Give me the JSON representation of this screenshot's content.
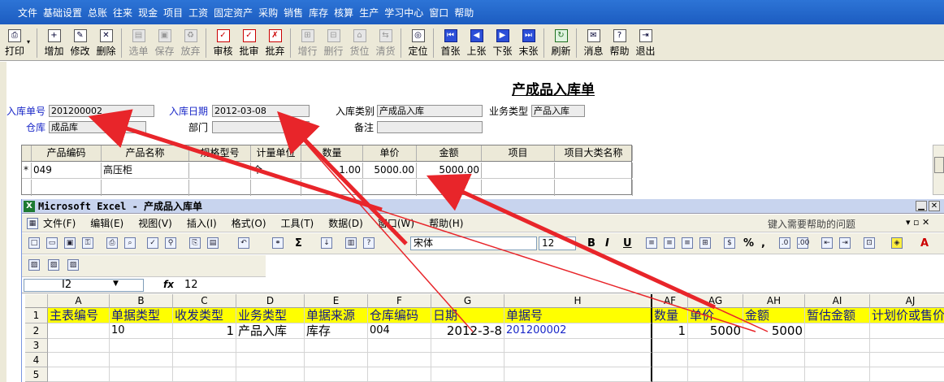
{
  "menubar": [
    "文件",
    "基础设置",
    "总账",
    "往来",
    "现金",
    "项目",
    "工资",
    "固定资产",
    "采购",
    "销售",
    "库存",
    "核算",
    "生产",
    "学习中心",
    "窗口",
    "帮助"
  ],
  "toolbar": {
    "print": "打印",
    "buttons": [
      {
        "label": "增加",
        "disabled": false,
        "icon": "plus-icon",
        "glyph": "+"
      },
      {
        "label": "修改",
        "disabled": false,
        "icon": "edit-icon",
        "glyph": "✎"
      },
      {
        "label": "删除",
        "disabled": false,
        "icon": "delete-icon",
        "glyph": "✕"
      },
      {
        "label": "选单",
        "disabled": true,
        "icon": "select-icon",
        "glyph": "▤"
      },
      {
        "label": "保存",
        "disabled": true,
        "icon": "save-icon",
        "glyph": "▣"
      },
      {
        "label": "放弃",
        "disabled": true,
        "icon": "trash-icon",
        "glyph": "♻"
      },
      {
        "label": "审核",
        "disabled": false,
        "icon": "audit-icon",
        "glyph": "✓",
        "tone": "red"
      },
      {
        "label": "批审",
        "disabled": false,
        "icon": "batch-audit-icon",
        "glyph": "✓",
        "tone": "red"
      },
      {
        "label": "批弃",
        "disabled": false,
        "icon": "batch-abandon-icon",
        "glyph": "✗",
        "tone": "red"
      },
      {
        "label": "增行",
        "disabled": true,
        "icon": "add-row-icon",
        "glyph": "⊞"
      },
      {
        "label": "删行",
        "disabled": true,
        "icon": "delete-row-icon",
        "glyph": "⊟"
      },
      {
        "label": "货位",
        "disabled": true,
        "icon": "location-icon",
        "glyph": "⌂"
      },
      {
        "label": "清货",
        "disabled": true,
        "icon": "clear-goods-icon",
        "glyph": "⇆"
      },
      {
        "label": "定位",
        "disabled": false,
        "icon": "locate-icon",
        "glyph": "◎"
      },
      {
        "label": "首张",
        "disabled": false,
        "icon": "first-icon",
        "glyph": "⏮",
        "tone": "blue"
      },
      {
        "label": "上张",
        "disabled": false,
        "icon": "prev-icon",
        "glyph": "◀",
        "tone": "blue"
      },
      {
        "label": "下张",
        "disabled": false,
        "icon": "next-icon",
        "glyph": "▶",
        "tone": "blue"
      },
      {
        "label": "末张",
        "disabled": false,
        "icon": "last-icon",
        "glyph": "⏭",
        "tone": "blue"
      },
      {
        "label": "刷新",
        "disabled": false,
        "icon": "refresh-icon",
        "glyph": "↻",
        "tone": "green"
      },
      {
        "label": "消息",
        "disabled": false,
        "icon": "message-icon",
        "glyph": "✉"
      },
      {
        "label": "帮助",
        "disabled": false,
        "icon": "help-icon",
        "glyph": "?"
      },
      {
        "label": "退出",
        "disabled": false,
        "icon": "exit-icon",
        "glyph": "⇥"
      }
    ]
  },
  "form": {
    "title": "产成品入库单",
    "doc_no_label": "入库单号",
    "doc_no": "201200002",
    "date_label": "入库日期",
    "date": "2012-03-08",
    "type_label": "入库类别",
    "type": "产成品入库",
    "biz_label": "业务类型",
    "biz": "产品入库",
    "wh_label": "仓库",
    "wh": "成品库",
    "dept_label": "部门",
    "dept": "",
    "note_label": "备注",
    "note": "",
    "grid_headers": [
      "产品编码",
      "产品名称",
      "规格型号",
      "计量单位",
      "数量",
      "单价",
      "金额",
      "项目",
      "项目大类名称"
    ],
    "grid_row": {
      "marker": "*",
      "code": "049",
      "name": "高压柜",
      "spec": "",
      "unit": "个",
      "qty": "1.00",
      "price": "5000.00",
      "amount": "5000.00",
      "proj": "",
      "projcat": ""
    }
  },
  "excel": {
    "title": "Microsoft Excel - 产成品入库单",
    "menu": [
      "文件(F)",
      "编辑(E)",
      "视图(V)",
      "插入(I)",
      "格式(O)",
      "工具(T)",
      "数据(D)",
      "窗口(W)",
      "帮助(H)"
    ],
    "help_placeholder": "键入需要帮助的问题",
    "font_name": "宋体",
    "font_size": "12",
    "name_box": "I2",
    "fx": "fx",
    "formula_value": "12",
    "col_letters": [
      "A",
      "B",
      "C",
      "D",
      "E",
      "F",
      "G",
      "H",
      "AF",
      "AG",
      "AH",
      "AI",
      "AJ"
    ],
    "row_numbers": [
      "1",
      "2",
      "3",
      "4",
      "5"
    ],
    "header_row": [
      "主表编号",
      "单据类型",
      "收发类型",
      "业务类型",
      "单据来源",
      "仓库编码",
      "日期",
      "单据号",
      "数量",
      "单价",
      "金额",
      "暂估金额",
      "计划价或售价"
    ],
    "data_row": [
      "",
      "10",
      "1",
      "产品入库",
      "库存",
      "004",
      "2012-3-8",
      "201200002",
      "1",
      "5000",
      "5000",
      "",
      ""
    ]
  }
}
